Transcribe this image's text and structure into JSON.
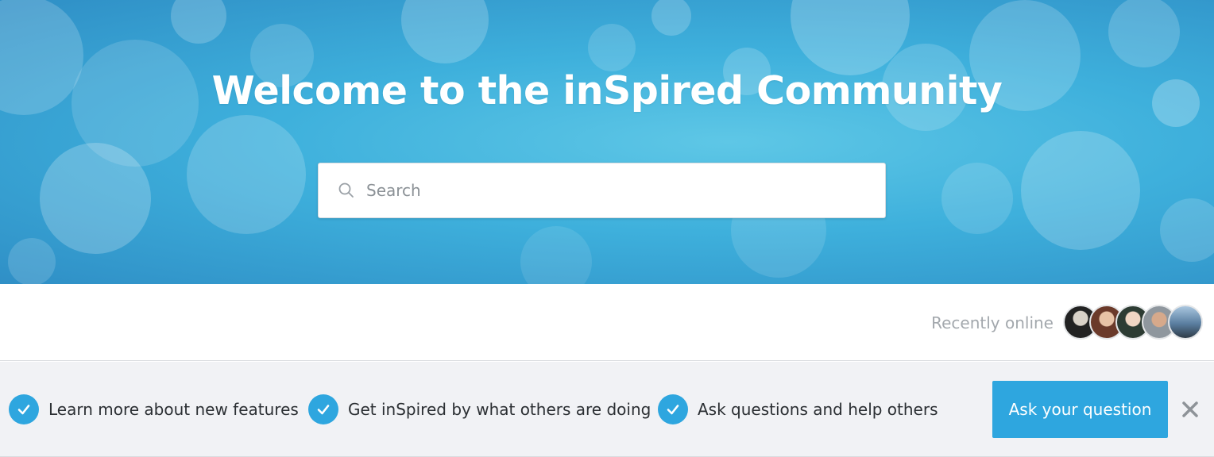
{
  "hero": {
    "title": "Welcome to the inSpired Community",
    "search": {
      "placeholder": "Search",
      "value": "",
      "icon": "search-icon"
    }
  },
  "recently_online": {
    "label": "Recently online",
    "avatars": [
      {
        "name": "avatar-1",
        "color": "#2b2b2b"
      },
      {
        "name": "avatar-2",
        "color": "#7a4a3a"
      },
      {
        "name": "avatar-3",
        "color": "#3d5a46"
      },
      {
        "name": "avatar-4",
        "color": "#9aa0a6"
      },
      {
        "name": "avatar-5",
        "color": "#5f7f9e"
      }
    ]
  },
  "info_bar": {
    "features": [
      {
        "label": "Learn more about new features",
        "icon": "check-icon"
      },
      {
        "label": "Get inSpired by what others are doing",
        "icon": "check-icon"
      },
      {
        "label": "Ask questions and help others",
        "icon": "check-icon"
      }
    ],
    "ask_button": "Ask your question",
    "close_icon": "close-icon"
  },
  "colors": {
    "accent": "#2ea6df",
    "hero_light": "#5ec7e6",
    "hero_dark": "#2f8fc6",
    "info_bg": "#f1f2f5",
    "muted_text": "#a3a8ad"
  }
}
